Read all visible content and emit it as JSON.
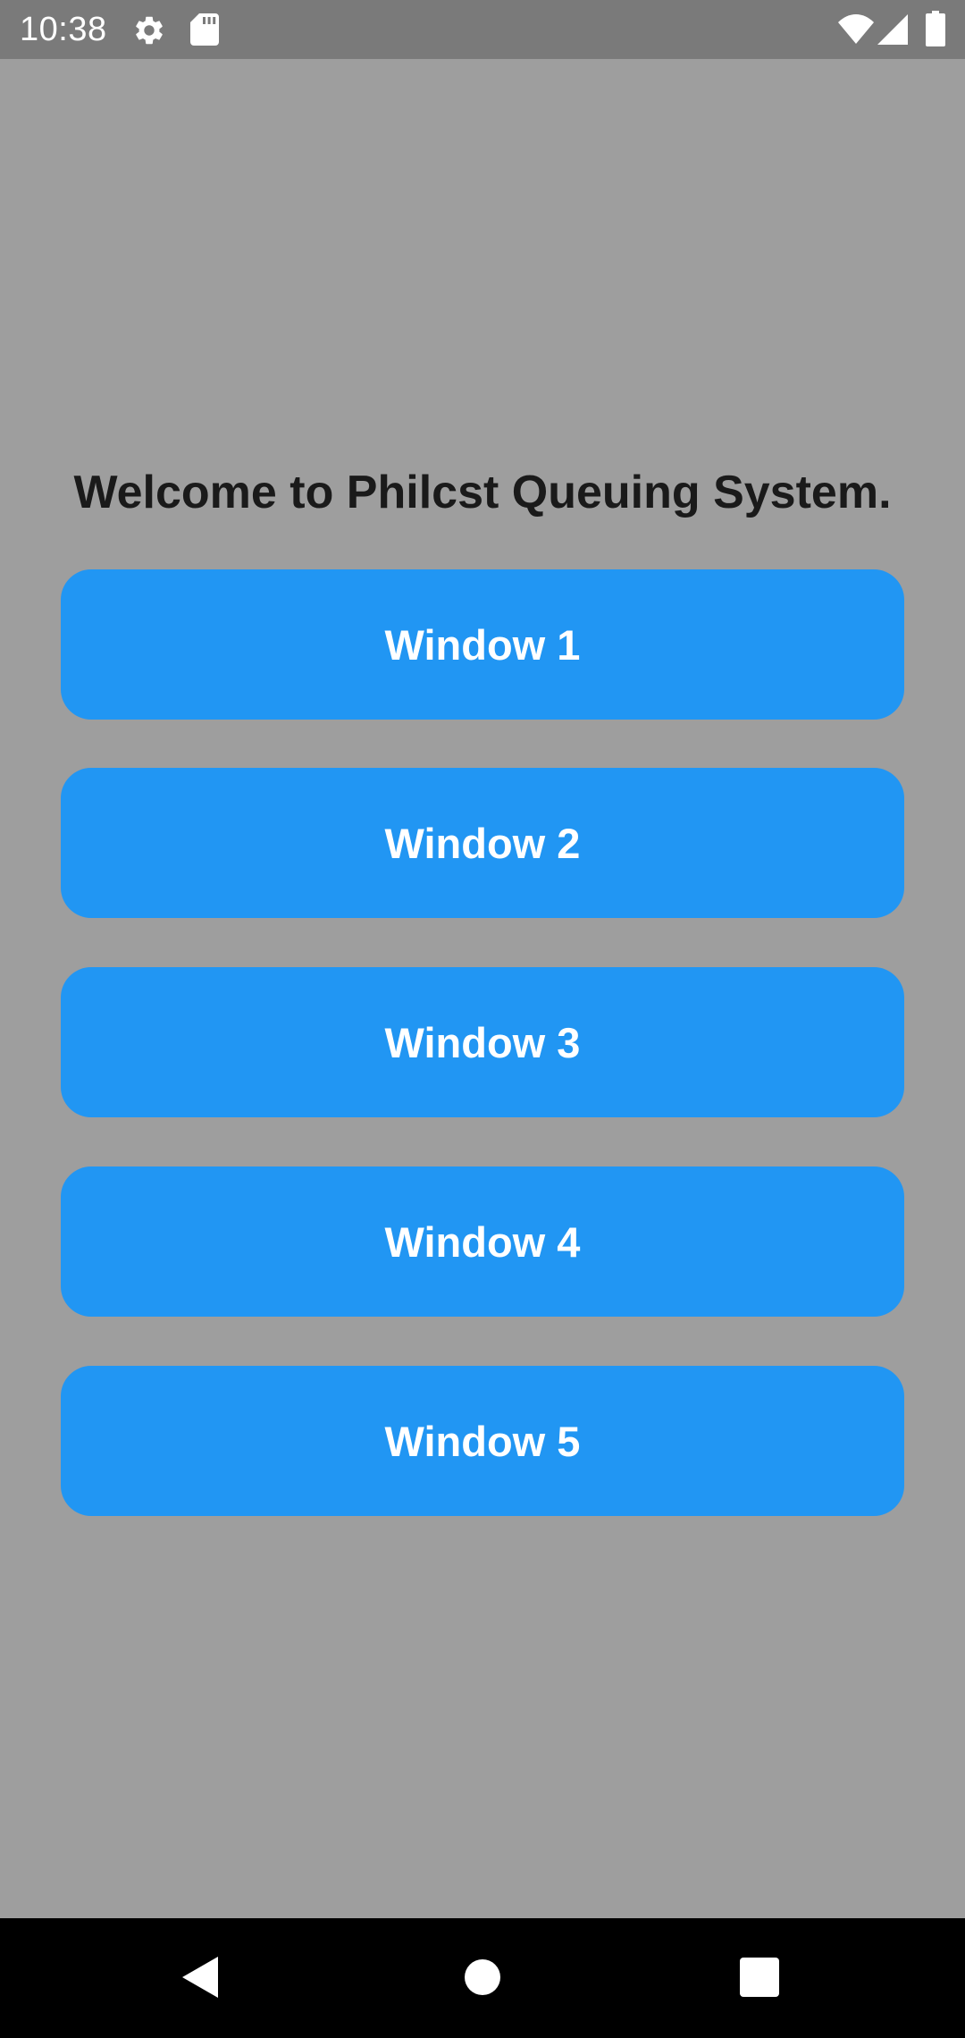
{
  "status_bar": {
    "time": "10:38",
    "icons": [
      "gear-icon",
      "sd-card-icon",
      "wifi-icon",
      "signal-icon",
      "battery-icon"
    ]
  },
  "main": {
    "title": "Welcome to Philcst Queuing System.",
    "buttons": [
      {
        "label": "Window 1"
      },
      {
        "label": "Window 2"
      },
      {
        "label": "Window 3"
      },
      {
        "label": "Window 4"
      },
      {
        "label": "Window 5"
      }
    ]
  },
  "nav_bar": {
    "icons": [
      "back-icon",
      "home-icon",
      "recents-icon"
    ]
  },
  "colors": {
    "background": "#9e9e9e",
    "status_bar": "#7a7a7a",
    "button": "#2196f3",
    "button_text": "#ffffff",
    "title_text": "#1a1a1a",
    "nav_bar": "#000000"
  }
}
